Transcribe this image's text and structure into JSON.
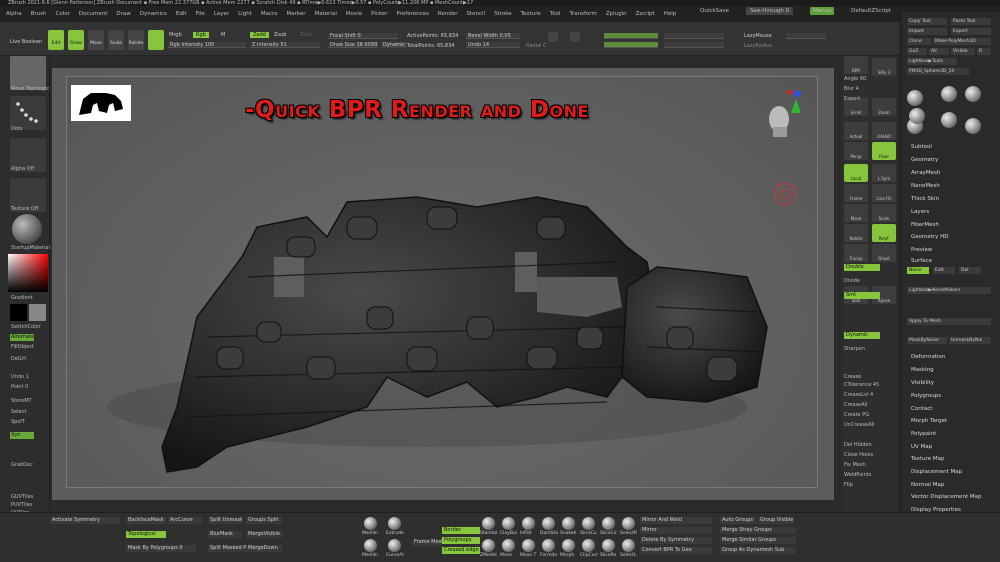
{
  "titlebar": {
    "text": "ZBrush 2021.6.6 [Glenn Patterson]   ZBrush Document     ▪ Free Mem 22.377GB  ▪ Active Mem 2277  ▪ Scratch Disk 49  ▪ RTime▶0.613 Timer▶0.57  ▪ PolyCount▶11.206 MP  ▪ MeshCount▶17"
  },
  "menu": {
    "items": [
      "Alpha",
      "Brush",
      "Color",
      "Document",
      "Draw",
      "Dynamics",
      "Edit",
      "File",
      "Layer",
      "Light",
      "Macro",
      "Marker",
      "Material",
      "Movie",
      "Picker",
      "Preferences",
      "Render",
      "Stencil",
      "Stroke",
      "Texture",
      "Tool",
      "Transform",
      "Zplugin",
      "Zscript",
      "Help"
    ],
    "quicksave": "QuickSave",
    "seethrough": "See-through  0",
    "menus": "Menus",
    "script": "DefaultZScript"
  },
  "toolbar": {
    "live_boolean": "Live Boolean",
    "edit": "Edit",
    "draw": "Draw",
    "move": "Move",
    "scale": "Scale",
    "rotate": "Rotate",
    "mrgb": "Mrgb",
    "rgb": "Rgb",
    "m": "M",
    "zadd": "Zadd",
    "zsub": "Zsub",
    "zcut": "Zcut",
    "rgb_intensity": "Rgb Intensity 100",
    "z_intensity": "Z Intensity 51",
    "focal_shift": "Focal Shift 0",
    "draw_size": "Draw Size 38.60993",
    "dynamic": "Dynamic",
    "active_points": "ActivePoints: 65,834",
    "total_points": "TotalPoints: 65,834",
    "bevel_width": "Bevel Width 0.05",
    "undo": "Undo 14",
    "radial": "Radial C",
    "lazymouse": "LazyMouse",
    "lazyradius": "LazyRadius"
  },
  "left": {
    "brush": "Move Topologic",
    "stroke": "Dots",
    "alpha": "Alpha Off",
    "texture": "Texture Off",
    "material": "StartupMaterial",
    "gradient": "Gradient",
    "switchcolor": "SwitchColor",
    "alternate": "Alternate",
    "fillobject": "FillObject",
    "items": [
      "DelLH",
      "Undo 1",
      "Point 0",
      "StoreMT",
      "Select",
      "SpolT",
      "Xyz",
      "GrabDoc",
      "GUVTiles",
      "PUVTiles",
      "UVTiles"
    ]
  },
  "canvas": {
    "headline": "-Quick BPR Render and Done"
  },
  "rightstrip": {
    "buttons": [
      "BPR",
      "SPix 3",
      "Scroll",
      "Zoom",
      "Actual",
      "AAHalf",
      "Persp",
      "Floor",
      "Local",
      "L.Sym",
      "Frame",
      "Move",
      "Scale",
      "Rotate",
      "Line Fill",
      "PolyF",
      "Transp",
      "Ghost",
      "Solo",
      "Xpose"
    ],
    "labels": [
      "Angle 60",
      "Blur 4",
      "Export",
      "Double",
      "Divide",
      "Smt",
      "Dynamic",
      "Sharpen",
      "Crease",
      "CTolerance 45",
      "CreaseLvl 4",
      "CreaseAll",
      "Create PG",
      "UnCreaseAll",
      "Del Hidden",
      "Close Holes",
      "Fix Mesh",
      "WeldPoints",
      "Flip",
      "Split Screen"
    ]
  },
  "rightpanel": {
    "top_buttons": [
      "Copy Tool",
      "Paste Tool",
      "Import",
      "Export",
      "Clone",
      "Make PolyMesh3D",
      "GoZ",
      "All",
      "Visible",
      "R",
      "Lightbox▶Tools",
      "PM3D_Sphere3D_50"
    ],
    "tools": [
      "PM3D_Sphere3",
      "Sphere3D",
      "PolyMesh3D",
      "SimpleBrush",
      "Cylinder3D",
      "Sphere",
      "PM3D_Sphe"
    ],
    "sections": [
      "Subtool",
      "Geometry",
      "ArrayMesh",
      "NanoMesh",
      "Thick Skin",
      "Layers",
      "FiberMesh",
      "Geometry HD",
      "Preview",
      "Surface",
      "Deformation",
      "Masking",
      "Visibility",
      "Polygroups",
      "Contact",
      "Morph Target",
      "Polypaint",
      "UV Map",
      "Texture Map",
      "Displacement Map",
      "Normal Map",
      "Vector Displacement Map",
      "Display Properties",
      "Unified Skin",
      "Initialize",
      "Import",
      "Export"
    ],
    "noise": "Noise",
    "edit": "Edit",
    "del": "Del",
    "lightbox_noise": "Lightbox▶NoiseMakers",
    "apply_mesh": "Apply To Mesh",
    "mask_by_noise": "MaskByNoise",
    "unmask_by_noise": "UnmaskByNoi"
  },
  "bottom": {
    "left": [
      "Activate Symmetry",
      "BackfaceMask",
      "ArcCurve",
      "Topological",
      "Mask By Polygroups 0",
      "Split Unmask",
      "Groups Split",
      "BlurMask",
      "Split Masked Points",
      "MergeVisible",
      "MergeDown"
    ],
    "brushes": [
      "MeshIn",
      "Extrude",
      "MeshIn",
      "CurveAl",
      "Standar",
      "ClayBui",
      "Inflat",
      "DamSta",
      "Snakeh",
      "SliceCu",
      "SliceCir",
      "SelectR",
      "ZModel",
      "Move",
      "Move T",
      "Formdo",
      "Morph",
      "ClipCurr",
      "SliceRe",
      "SelectL"
    ],
    "green": [
      "Border",
      "Polygroups",
      "Creased edge"
    ],
    "ops": [
      "Frame Mesh",
      "Mirror And Weld",
      "Mirror",
      "Delete By Symmetry",
      "Convert BPR To Geo",
      "Auto Groups",
      "Group Visible",
      "Merge Similar Groups",
      "Group As Dynamesh Sub",
      "Merge Stray Groups"
    ]
  }
}
